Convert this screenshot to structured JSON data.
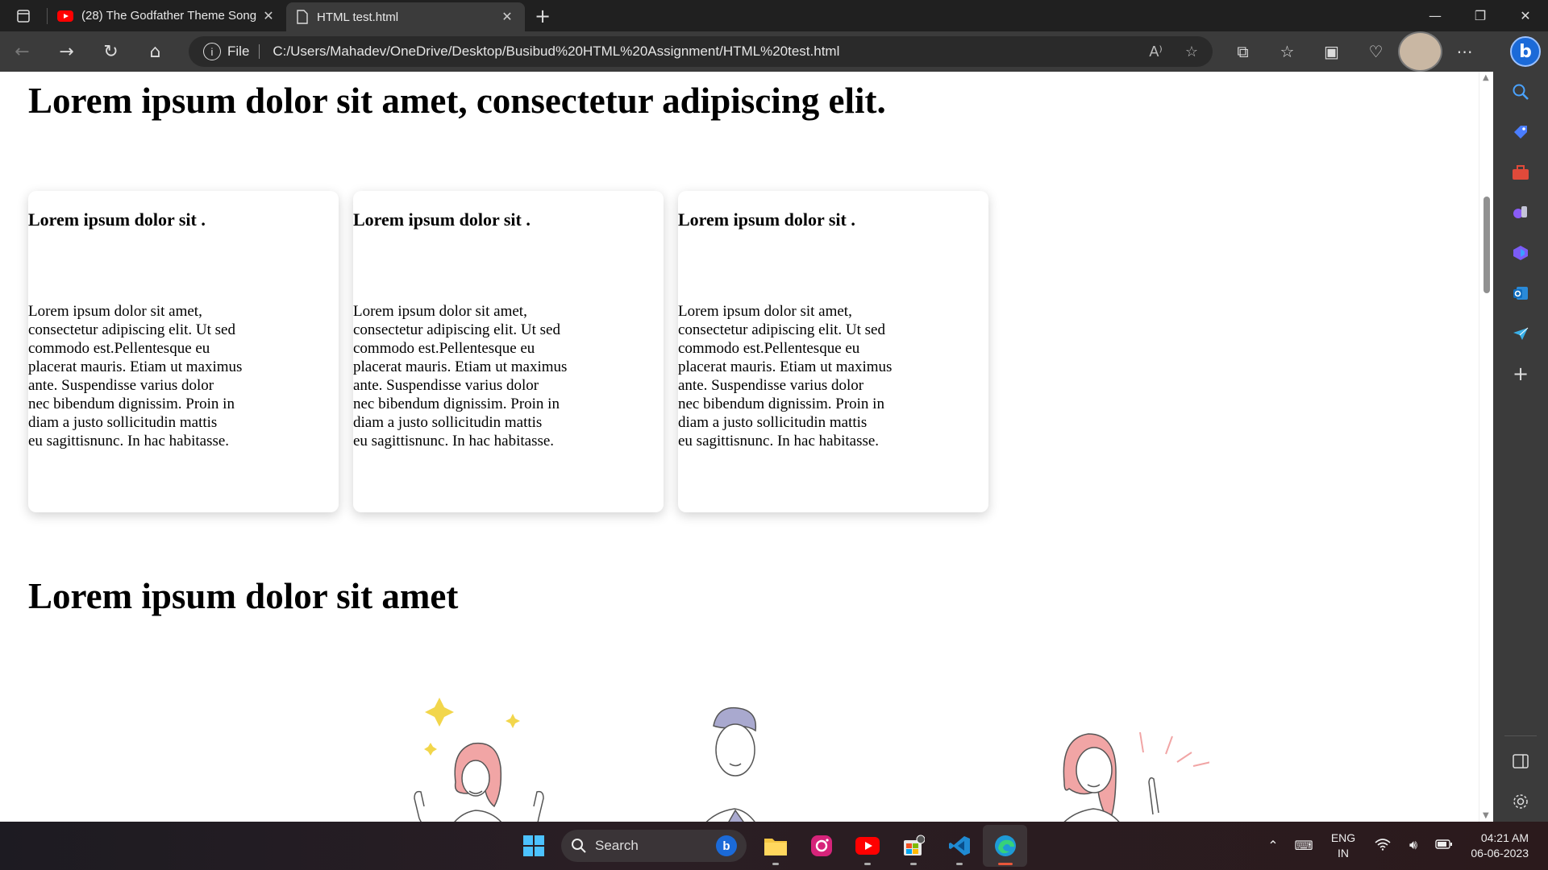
{
  "browser": {
    "tabs": [
      {
        "title": "(28) The Godfather Theme Song",
        "icon": "youtube-icon"
      },
      {
        "title": "HTML test.html",
        "icon": "file-icon"
      }
    ],
    "address": {
      "scheme_label": "File",
      "url": "C:/Users/Mahadev/OneDrive/Desktop/Busibud%20HTML%20Assignment/HTML%20test.html"
    }
  },
  "page": {
    "heading": "Lorem ipsum dolor sit amet, consectetur adipiscing elit.",
    "cards": [
      {
        "title": "Lorem ipsum dolor sit .",
        "lines": [
          "Lorem ipsum dolor sit amet,",
          "consectetur adipiscing elit. Ut sed",
          "commodo est.Pellentesque eu",
          "placerat mauris. Etiam ut maximus",
          "ante. Suspendisse varius dolor",
          "nec bibendum dignissim. Proin in",
          "diam a justo sollicitudin mattis",
          "eu sagittisnunc. In hac habitasse."
        ]
      },
      {
        "title": "Lorem ipsum dolor sit .",
        "lines": [
          "Lorem ipsum dolor sit amet,",
          "consectetur adipiscing elit. Ut sed",
          "commodo est.Pellentesque eu",
          "placerat mauris. Etiam ut maximus",
          "ante. Suspendisse varius dolor",
          "nec bibendum dignissim. Proin in",
          "diam a justo sollicitudin mattis",
          "eu sagittisnunc. In hac habitasse."
        ]
      },
      {
        "title": "Lorem ipsum dolor sit .",
        "lines": [
          "Lorem ipsum dolor sit amet,",
          "consectetur adipiscing elit. Ut sed",
          "commodo est.Pellentesque eu",
          "placerat mauris. Etiam ut maximus",
          "ante. Suspendisse varius dolor",
          "nec bibendum dignissim. Proin in",
          "diam a justo sollicitudin mattis",
          "eu sagittisnunc. In hac habitasse."
        ]
      }
    ],
    "subheading": "Lorem ipsum dolor sit amet"
  },
  "taskbar": {
    "search_label": "Search",
    "language": {
      "line1": "ENG",
      "line2": "IN"
    },
    "clock": {
      "time": "04:21 AM",
      "date": "06-06-2023"
    }
  },
  "colors": {
    "accent": "#1b6ad8",
    "taskbar_active": "#e8563a"
  }
}
